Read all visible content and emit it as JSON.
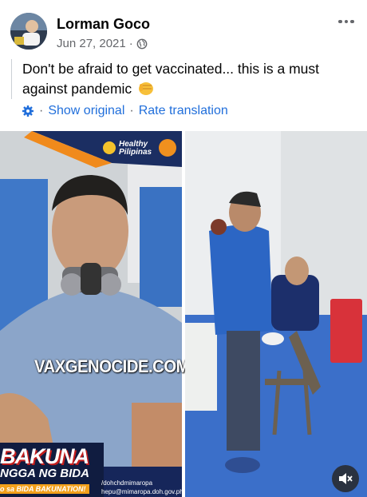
{
  "post": {
    "author": "Lorman Goco",
    "date": "Jun 27, 2021",
    "date_separator": "·",
    "text": "Don't be afraid to get vaccinated... this is a must against pandemic",
    "text_emoji": "punch-emoji",
    "translation": {
      "show_original": "Show original",
      "separator": "·",
      "rate_translation": "Rate translation"
    }
  },
  "media": {
    "left_photo": {
      "watermark": "VAXGENOCIDE.COM",
      "brand_text": "Healthy Pilipinas",
      "banner_big": "BAKUNA",
      "banner_line2": "NGGA NG BIDA",
      "banner_line3": "o sa BIDA BAKUNATION!",
      "contact_1": "/dohchdmimaropa",
      "contact_2": "hepu@mimaropa.doh.gov.ph"
    },
    "right_video": {
      "mute_icon": "speaker-muted-icon"
    }
  },
  "colors": {
    "link": "#216fdb",
    "meta": "#65676b",
    "text": "#050505"
  }
}
